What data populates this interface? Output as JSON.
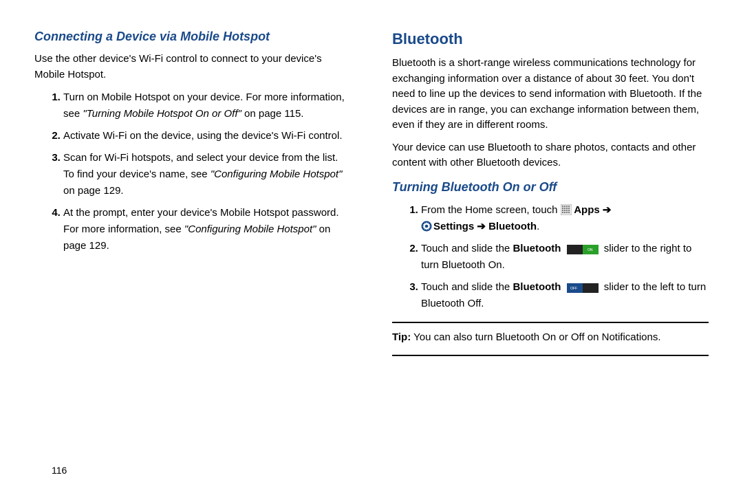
{
  "page_number": "116",
  "left": {
    "heading": "Connecting a Device via Mobile Hotspot",
    "intro": "Use the other device's Wi-Fi control to connect to your device's Mobile Hotspot.",
    "steps": {
      "s1_a": "Turn on Mobile Hotspot on your device. For more information, see ",
      "s1_ref": "\"Turning Mobile Hotspot On or Off\"",
      "s1_b": " on page 115.",
      "s2": "Activate Wi-Fi on the device, using the device's Wi-Fi control.",
      "s3_a": "Scan for Wi-Fi hotspots, and select your device from the list. To find your device's name, see ",
      "s3_ref": "\"Configuring Mobile Hotspot\"",
      "s3_b": " on page 129.",
      "s4_a": "At the prompt, enter your device's Mobile Hotspot password. For more information, see ",
      "s4_ref": "\"Configuring Mobile Hotspot\"",
      "s4_b": " on page 129."
    }
  },
  "right": {
    "title": "Bluetooth",
    "p1": "Bluetooth is a short-range wireless communications technology for exchanging information over a distance of about 30 feet. You don't need to line up the devices to send information with Bluetooth. If the devices are in range, you can exchange information between them, even if they are in different rooms.",
    "p2": "Your device can use Bluetooth to share photos, contacts and other content with other Bluetooth devices.",
    "sub_heading": "Turning Bluetooth On or Off",
    "steps": {
      "s1_a": "From the Home screen, touch ",
      "s1_apps": " Apps ➔ ",
      "s1_settings": "Settings ➔ Bluetooth",
      "s1_end": ".",
      "s2_a": "Touch and slide the ",
      "s2_bold": "Bluetooth",
      "s2_b": " slider to the right to turn Bluetooth On.",
      "s3_a": "Touch and slide the ",
      "s3_bold": "Bluetooth",
      "s3_b": " slider to the left to turn Bluetooth Off."
    },
    "tip_label": "Tip:",
    "tip_text": " You can also turn Bluetooth On or Off on Notifications."
  }
}
